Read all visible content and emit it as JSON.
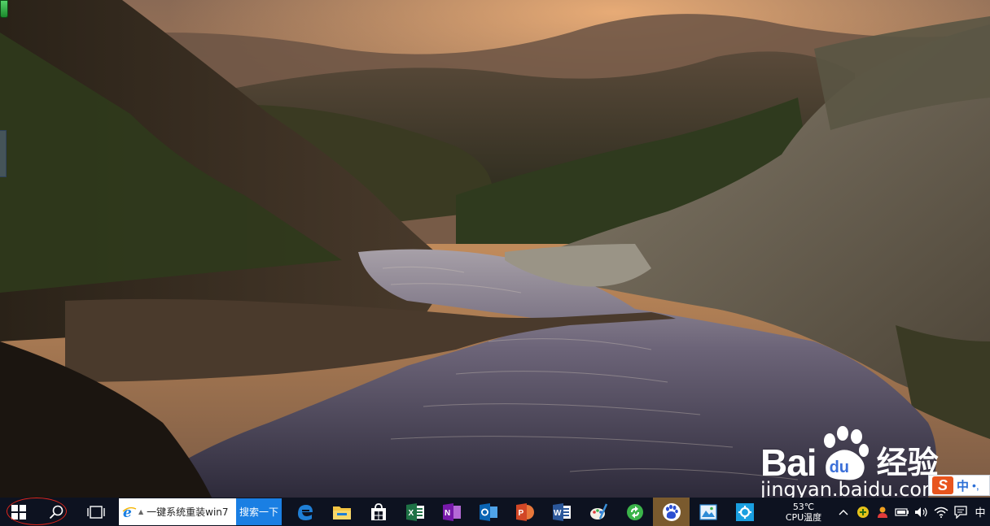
{
  "desktop": {
    "wallpaper": "sunset rocky river canyon",
    "watermark": {
      "bai": "Bai",
      "du": "du",
      "cn": "经验",
      "url": "jingyan.baidu.com"
    },
    "ime_bar": {
      "logo": "S",
      "mode": "中",
      "extra": "•,"
    }
  },
  "taskbar": {
    "start_icon": "windows-logo",
    "search_icon": "magnifier",
    "taskview_icon": "task-view",
    "ie_search": {
      "text": "一键系统重装win7",
      "go_label": "搜索一下"
    },
    "apps": [
      {
        "name": "edge",
        "color": "#1f7fd6"
      },
      {
        "name": "file-explorer",
        "color": "#f4c543"
      },
      {
        "name": "store",
        "color": "#ffffff"
      },
      {
        "name": "excel",
        "color": "#1e7145"
      },
      {
        "name": "onenote",
        "color": "#7719aa"
      },
      {
        "name": "outlook",
        "color": "#0a64b3"
      },
      {
        "name": "powerpoint",
        "color": "#d24726"
      },
      {
        "name": "word",
        "color": "#2b579a"
      },
      {
        "name": "paint-tool",
        "color": "#3a8fd8"
      },
      {
        "name": "sync-green",
        "color": "#3bb44a"
      },
      {
        "name": "baidu-paw",
        "color": "#2b4fd1"
      },
      {
        "name": "image-viewer",
        "color": "#2e8bd6"
      },
      {
        "name": "settings-gear",
        "color": "#1a9fe0"
      }
    ],
    "tray": {
      "temperature": "53℃",
      "temperature_label": "CPU温度",
      "language": "中"
    },
    "accent_annotation": "#e0261c"
  }
}
